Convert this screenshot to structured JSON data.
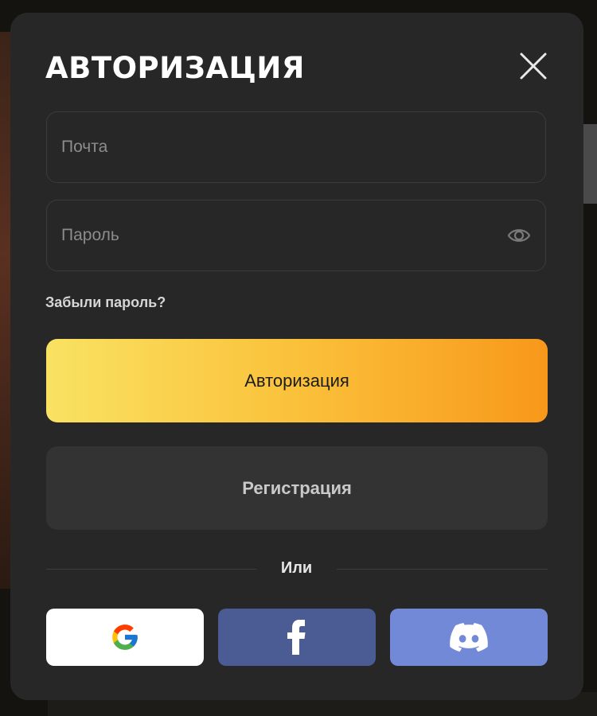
{
  "modal": {
    "title": "АВТОРИЗАЦИЯ",
    "close_icon": "close-icon"
  },
  "form": {
    "email": {
      "placeholder": "Почта",
      "value": ""
    },
    "password": {
      "placeholder": "Пароль",
      "value": "",
      "toggle_icon": "eye-icon"
    },
    "forgot_password": "Забыли пароль?",
    "login_button": "Авторизация",
    "register_button": "Регистрация",
    "divider": "Или"
  },
  "social": [
    {
      "name": "Google",
      "icon": "google-icon",
      "bg": "#ffffff"
    },
    {
      "name": "Facebook",
      "icon": "facebook-icon",
      "bg": "#4b5b94"
    },
    {
      "name": "Discord",
      "icon": "discord-icon",
      "bg": "#7289d8"
    }
  ],
  "colors": {
    "modal_bg": "#272727",
    "login_gradient": [
      "#f9e262",
      "#f8981b"
    ],
    "register_bg": "#333333"
  }
}
